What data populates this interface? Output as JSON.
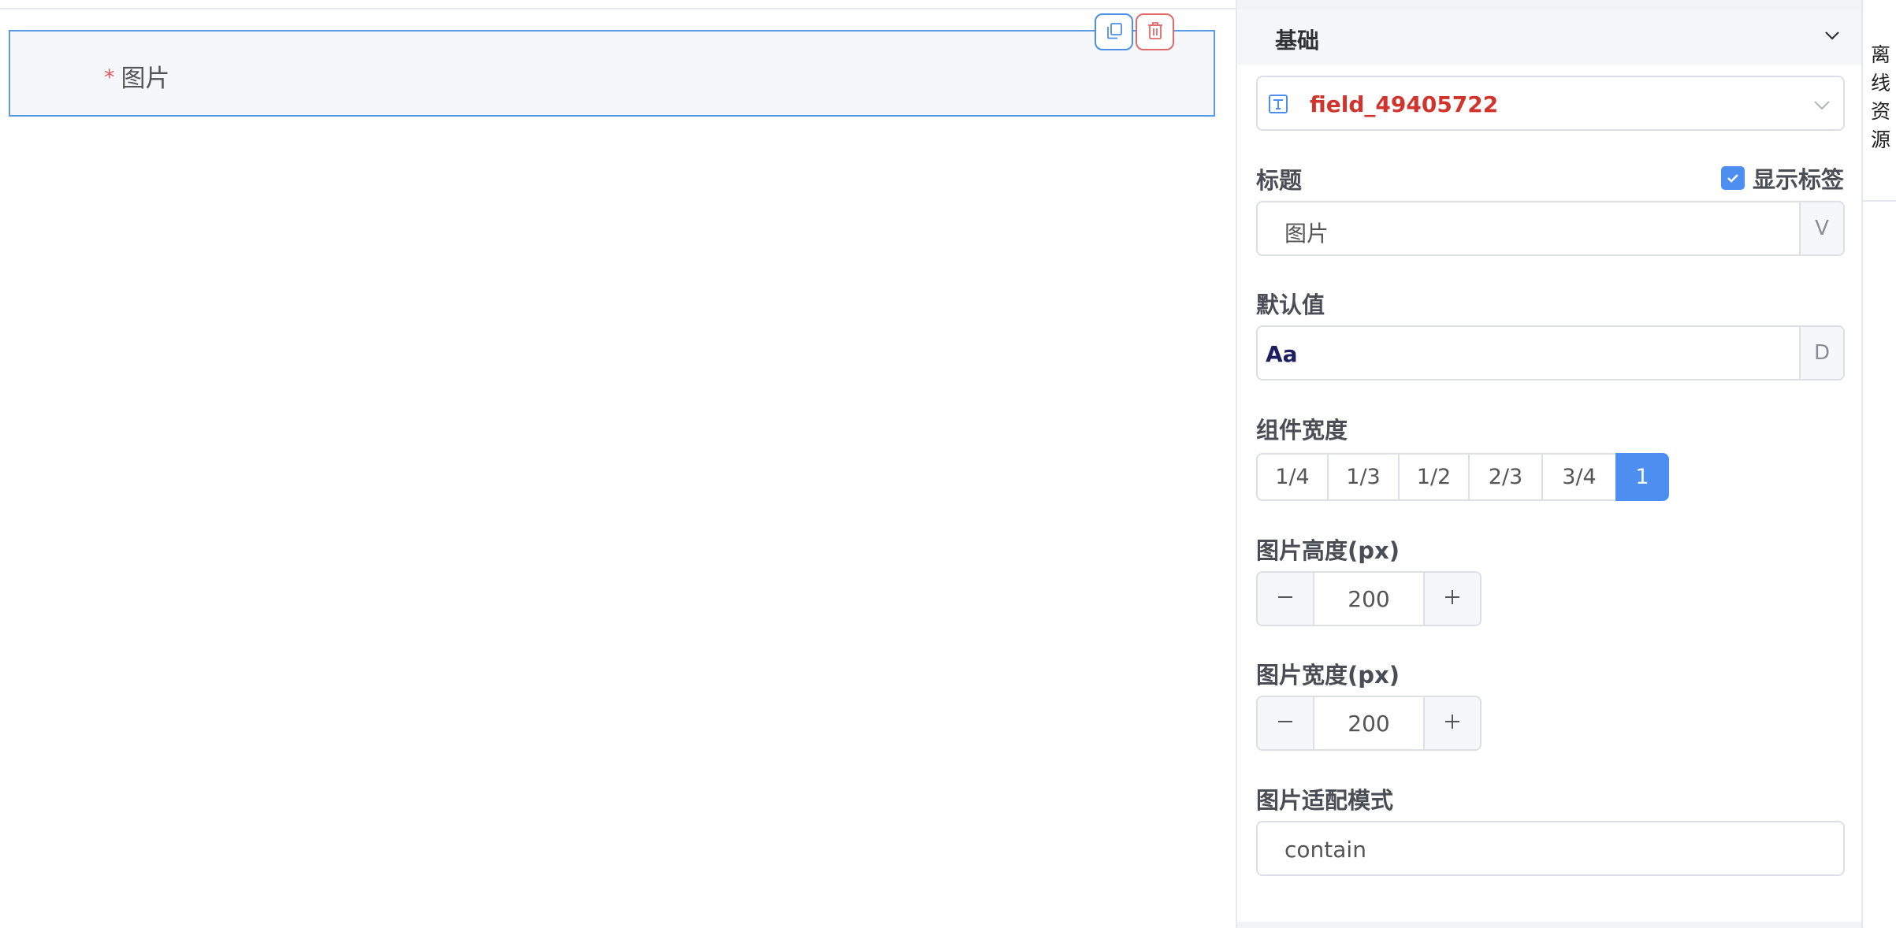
{
  "canvas": {
    "field_label": "图片",
    "required_mark": "*",
    "copy_icon": "copy-icon",
    "delete_icon": "trash-icon"
  },
  "panel": {
    "section_title": "基础",
    "field_id": "field_49405722",
    "title_label": "标题",
    "show_label_text": "显示标签",
    "show_label_checked": true,
    "title_value": "图片",
    "title_append": "V",
    "default_label": "默认值",
    "default_value": "Aa",
    "default_append": "D",
    "width_label": "组件宽度",
    "width_options": [
      "1/4",
      "1/3",
      "1/2",
      "2/3",
      "3/4",
      "1"
    ],
    "width_selected": "1",
    "height_label": "图片高度(px)",
    "height_value": "200",
    "img_width_label": "图片宽度(px)",
    "img_width_value": "200",
    "fit_label": "图片适配模式",
    "fit_value": "contain"
  },
  "side": {
    "tab_label": "离线资源"
  },
  "colors": {
    "accent": "#4d8ff0",
    "danger": "#e06a6a",
    "id_text": "#d1342c"
  }
}
